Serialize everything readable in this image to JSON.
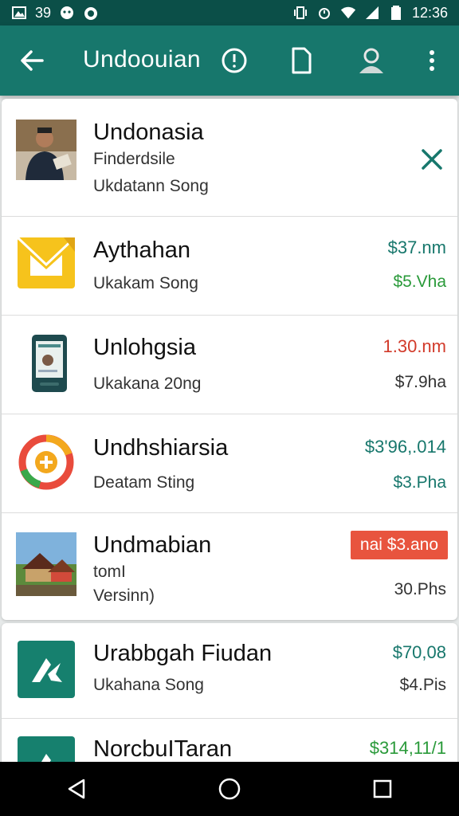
{
  "status_bar": {
    "left_text": "39",
    "time": "12:36",
    "icons_left": [
      "gallery-icon",
      "messenger-icon",
      "notification-icon"
    ],
    "icons_right": [
      "vibrate-icon",
      "alarm-icon",
      "wifi-icon",
      "signal-icon",
      "battery-icon"
    ]
  },
  "app_bar": {
    "title": "Undoouian",
    "icons": [
      "back-arrow-icon",
      "info-icon",
      "document-icon",
      "account-icon",
      "more-vert-icon"
    ]
  },
  "items": [
    {
      "title": "Undonasia",
      "subtitle": "Finderdsile",
      "subtitle2": "Ukdatann Song",
      "action": "close-icon",
      "thumbnail": "person-photo"
    },
    {
      "title": "Aythahan",
      "subtitle": "Ukakam Song",
      "price": "$37.nm",
      "amount": "$5.Vha",
      "thumbnail": "envelope-icon"
    },
    {
      "title": "Unlohgsia",
      "subtitle": "Ukakana 20ng",
      "price": "1.30.nm",
      "amount": "$7.9ha",
      "thumbnail": "phone-icon"
    },
    {
      "title": "Undhshiarsia",
      "subtitle": "Deatam Sting",
      "price": "$3'96,.014",
      "amount": "$3.Pha",
      "thumbnail": "ring-icon"
    },
    {
      "title": "Undmabian",
      "subtitle": "tomI",
      "subtitle2": "Versinn)",
      "badge": "nai  $3.ano",
      "amount": "30.Phs",
      "thumbnail": "house-photo"
    },
    {
      "title": "Urabbgah Fiudan",
      "subtitle": "Ukahana Song",
      "price": "$70,08",
      "amount": "$4.Pis",
      "thumbnail": "teal-logo"
    },
    {
      "title": "NorcbuITaran",
      "price": "$314,11/1",
      "thumbnail": "teal-logo"
    }
  ],
  "colors": {
    "app_bar": "#17776c",
    "status_bar": "#0b4f48",
    "price_teal": "#17776c",
    "amount_green": "#2a9a3a",
    "price_red": "#d23a2a",
    "badge": "#e8543e"
  },
  "nav_bar": {
    "icons": [
      "nav-back-icon",
      "nav-home-icon",
      "nav-recents-icon"
    ]
  }
}
